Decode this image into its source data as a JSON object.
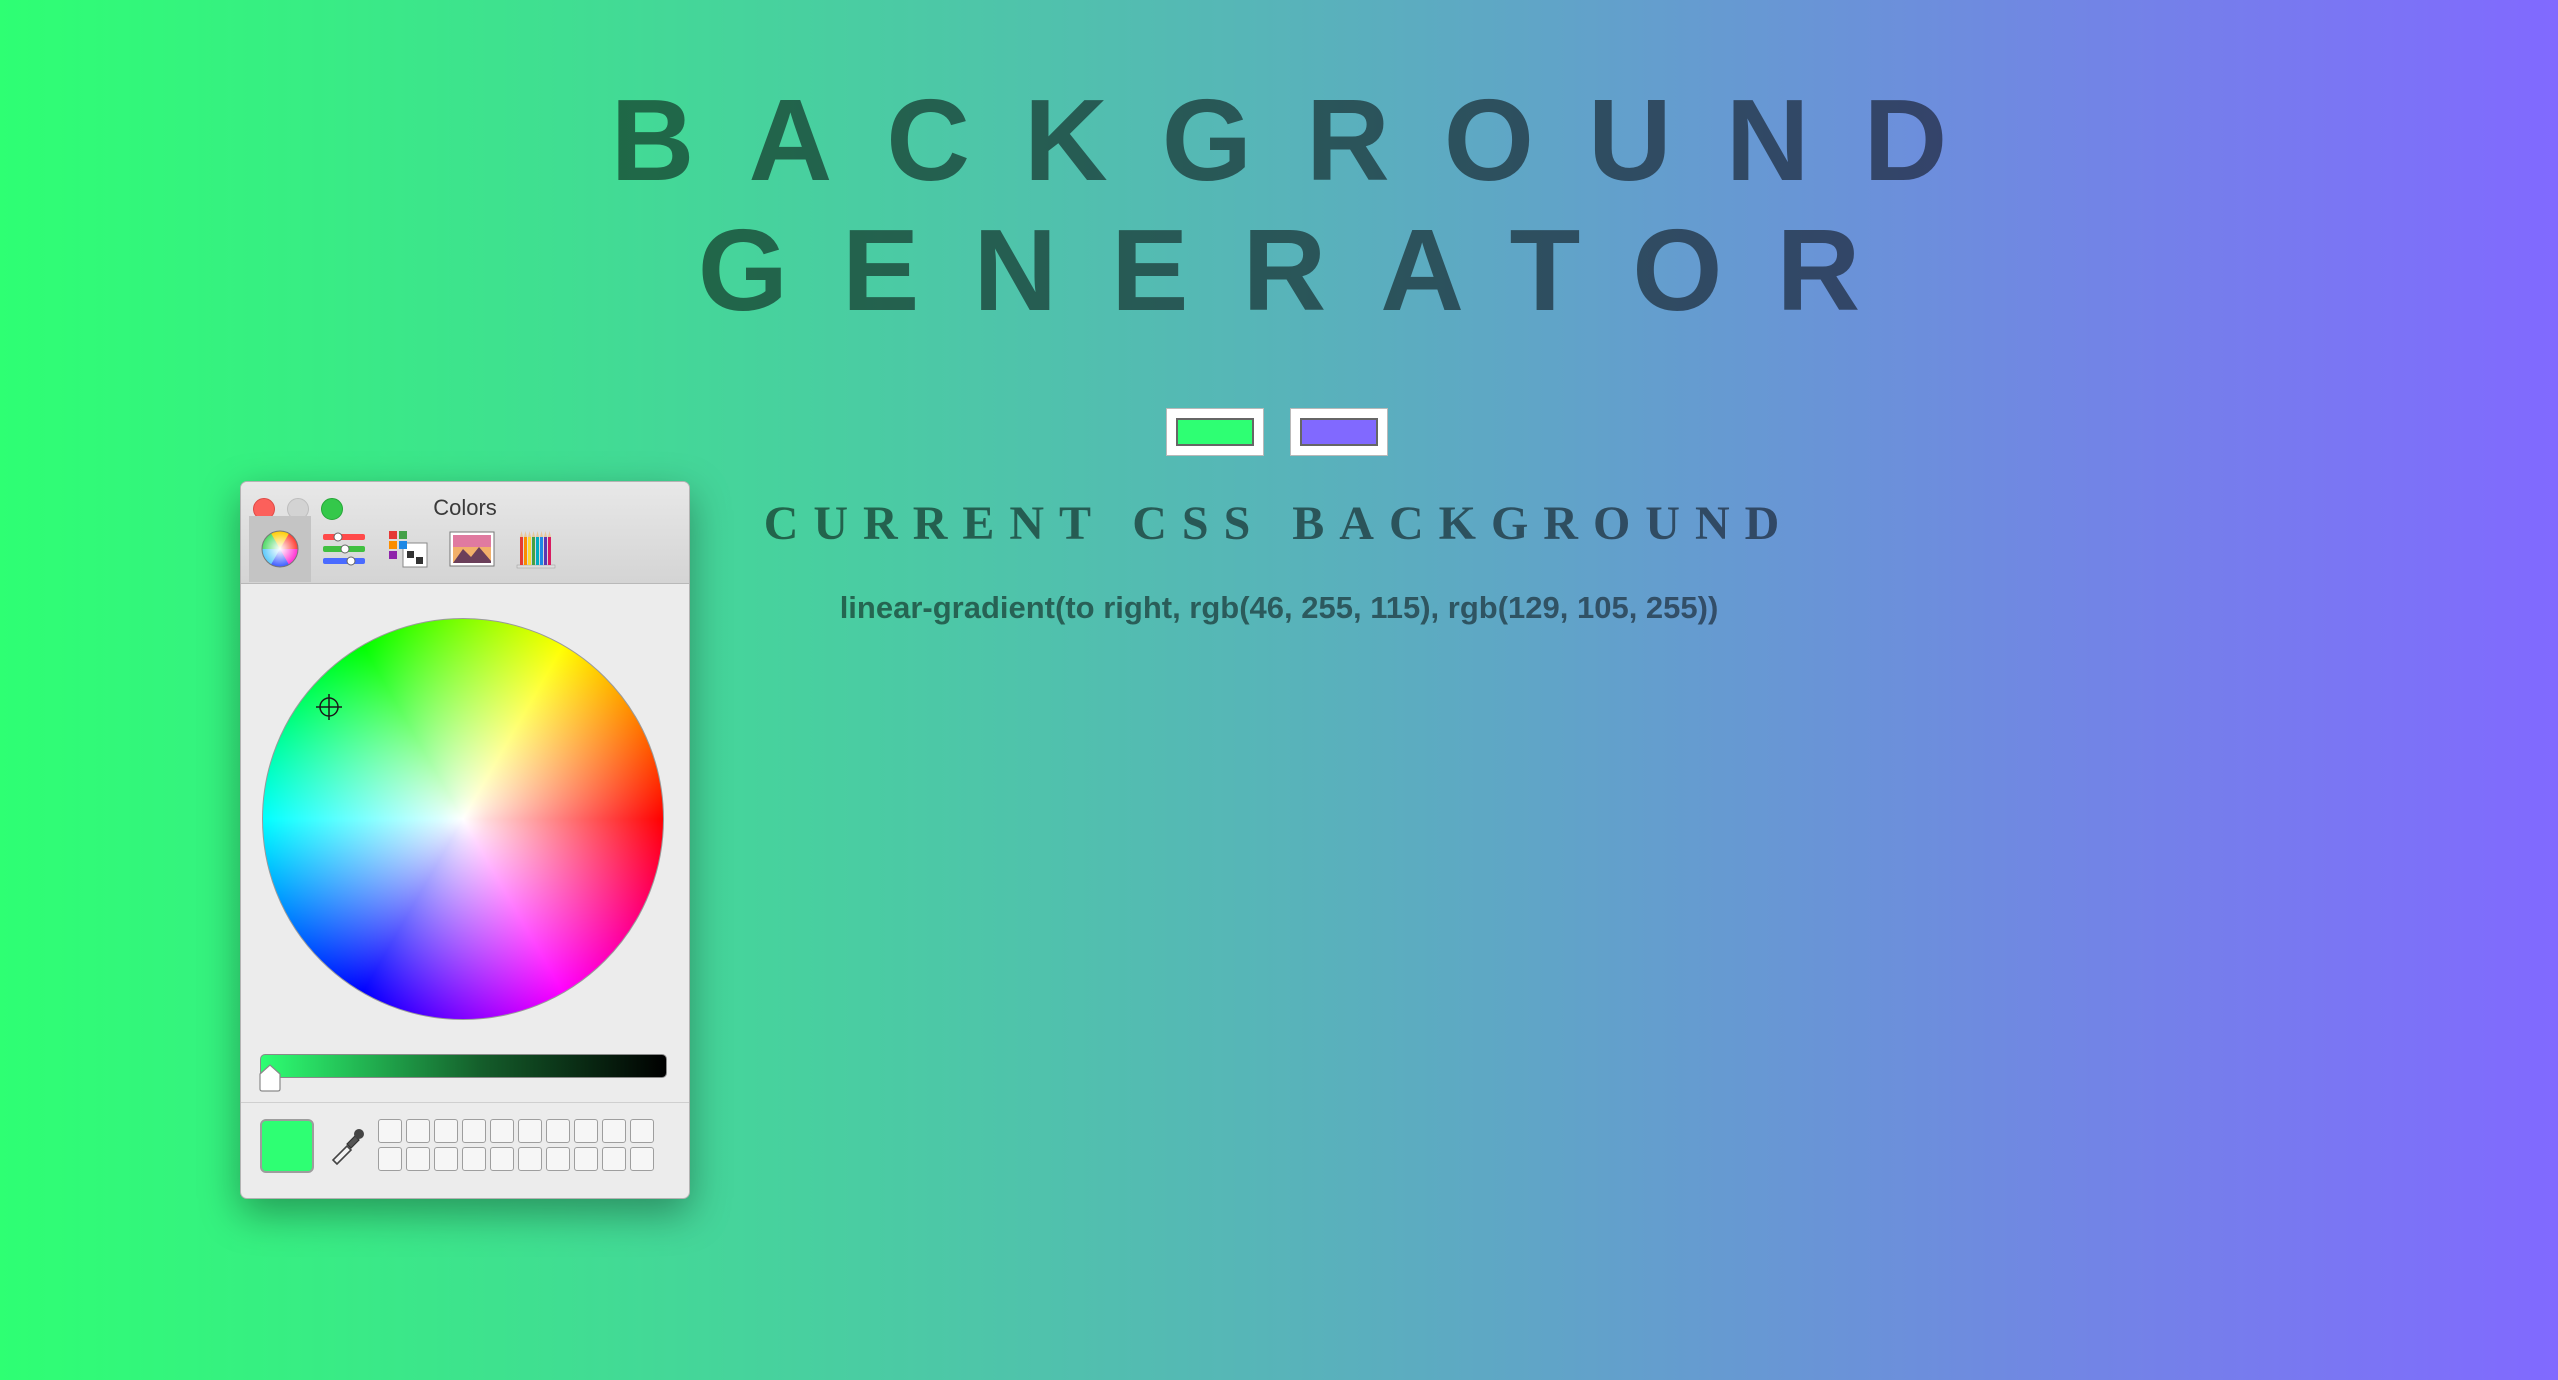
{
  "heading": {
    "line1": "BACKGROUND",
    "line2": "GENERATOR"
  },
  "color_inputs": [
    {
      "value": "#2eff73"
    },
    {
      "value": "#8169ff"
    }
  ],
  "subheading": "CURRENT CSS BACKGROUND",
  "css_output": "linear-gradient(to right, rgb(46, 255, 115), rgb(129, 105, 255))",
  "colors_panel": {
    "title": "Colors",
    "tabs": [
      "color-wheel-icon",
      "color-sliders-icon",
      "color-palettes-icon",
      "image-palettes-icon",
      "pencils-icon"
    ],
    "selected_tab": "color-wheel-icon",
    "current_color": "#2eff73",
    "swatch_rows": 2,
    "swatch_cols": 10
  },
  "colors": {
    "gradient_start": "#2eff73",
    "gradient_end": "#8169ff",
    "text": "rgba(0,0,0,0.52)"
  }
}
